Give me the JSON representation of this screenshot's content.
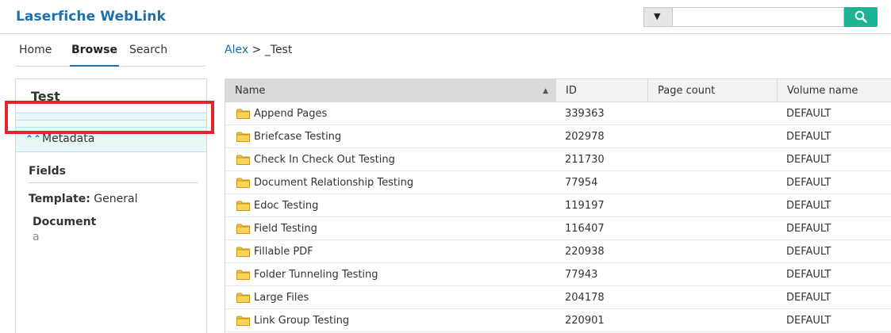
{
  "app": {
    "brand": "Laserfiche WebLink"
  },
  "search": {
    "placeholder": "",
    "dropdown_icon": "chevron-down-icon",
    "button_icon": "search-icon",
    "accent": "#1bb595"
  },
  "nav": {
    "tabs": [
      {
        "label": "Home"
      },
      {
        "label": "Browse",
        "active": true
      },
      {
        "label": "Search"
      }
    ]
  },
  "breadcrumb": {
    "root": "Alex",
    "separator": ">",
    "current": "_Test"
  },
  "sidebar": {
    "title": "Test",
    "metadata_label": "Metadata",
    "metadata_icon": "double-chevron-up-icon",
    "fields_title": "Fields",
    "template_label": "Template:",
    "template_value": "General",
    "field_name": "Document",
    "field_value": "a"
  },
  "table": {
    "columns": [
      {
        "label": "Name"
      },
      {
        "label": "ID"
      },
      {
        "label": "Page count"
      },
      {
        "label": "Volume name"
      }
    ],
    "rows": [
      {
        "name": "Append Pages",
        "id": "339363",
        "pages": "",
        "volume": "DEFAULT"
      },
      {
        "name": "Briefcase Testing",
        "id": "202978",
        "pages": "",
        "volume": "DEFAULT"
      },
      {
        "name": "Check In Check Out Testing",
        "id": "211730",
        "pages": "",
        "volume": "DEFAULT"
      },
      {
        "name": "Document Relationship Testing",
        "id": "77954",
        "pages": "",
        "volume": "DEFAULT"
      },
      {
        "name": "Edoc Testing",
        "id": "119197",
        "pages": "",
        "volume": "DEFAULT"
      },
      {
        "name": "Field Testing",
        "id": "116407",
        "pages": "",
        "volume": "DEFAULT"
      },
      {
        "name": "Fillable PDF",
        "id": "220938",
        "pages": "",
        "volume": "DEFAULT"
      },
      {
        "name": "Folder Tunneling Testing",
        "id": "77943",
        "pages": "",
        "volume": "DEFAULT"
      },
      {
        "name": "Large Files",
        "id": "204178",
        "pages": "",
        "volume": "DEFAULT"
      },
      {
        "name": "Link Group Testing",
        "id": "220901",
        "pages": "",
        "volume": "DEFAULT"
      }
    ]
  },
  "colors": {
    "brand": "#1f6fa8",
    "highlight": "#e0262b",
    "folder": "#f5c842"
  }
}
